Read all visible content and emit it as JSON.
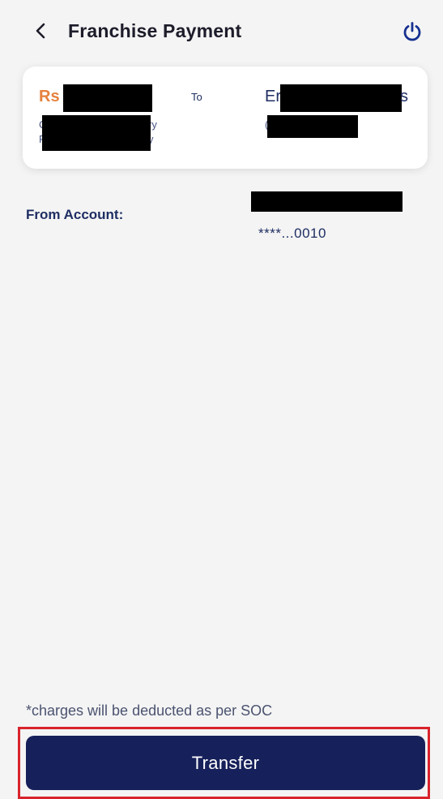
{
  "header": {
    "title": "Franchise Payment",
    "back_icon": "chevron-left-icon",
    "power_icon": "power-icon",
    "power_color": "#16308f"
  },
  "summary": {
    "amount_prefix": "Rs",
    "from_line1_start": "C",
    "from_line1_end": "ry",
    "from_line2_start": "F",
    "from_line2_end": "y",
    "to_label": "To",
    "payee_start": "Er",
    "payee_end": "s",
    "payee_line2_start": "(",
    "amount_color": "#e6813e"
  },
  "from_account": {
    "label": "From Account:",
    "masked_number": "****...0010"
  },
  "footer": {
    "charges_note": "*charges will be deducted as per SOC",
    "transfer_label": "Transfer",
    "button_color": "#16205a",
    "highlight_color": "#d9232c"
  }
}
